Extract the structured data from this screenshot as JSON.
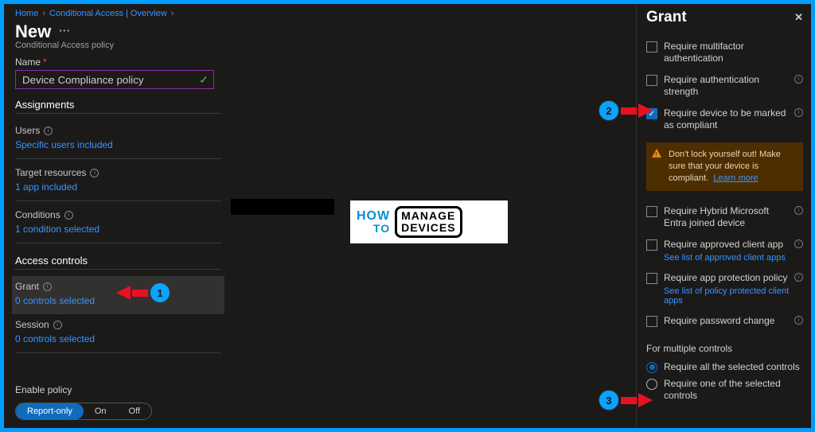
{
  "breadcrumb": {
    "home": "Home",
    "ca": "Conditional Access | Overview"
  },
  "page": {
    "title": "New",
    "subtitle": "Conditional Access policy"
  },
  "name": {
    "label": "Name",
    "value": "Device Compliance policy"
  },
  "sections": {
    "assignments": "Assignments",
    "access_controls": "Access controls"
  },
  "rows": {
    "users": {
      "label": "Users",
      "value": "Specific users included"
    },
    "target": {
      "label": "Target resources",
      "value": "1 app included"
    },
    "conditions": {
      "label": "Conditions",
      "value": "1 condition selected"
    },
    "grant": {
      "label": "Grant",
      "value": "0 controls selected"
    },
    "session": {
      "label": "Session",
      "value": "0 controls selected"
    }
  },
  "enable": {
    "label": "Enable policy",
    "report": "Report-only",
    "on": "On",
    "off": "Off"
  },
  "grant_panel": {
    "title": "Grant",
    "mfa": "Require multifactor authentication",
    "auth_strength": "Require authentication strength",
    "compliant": "Require device to be marked as compliant",
    "warn": "Don't lock yourself out! Make sure that your device is compliant.",
    "warn_link": "Learn more",
    "hybrid": "Require Hybrid Microsoft Entra joined device",
    "approved": "Require approved client app",
    "approved_link": "See list of approved client apps",
    "app_prot": "Require app protection policy",
    "app_prot_link": "See list of policy protected client apps",
    "pwd": "Require password change",
    "multi_label": "For multiple controls",
    "radio_all": "Require all the selected controls",
    "radio_one": "Require one of the selected controls"
  },
  "callouts": {
    "c1": "1",
    "c2": "2",
    "c3": "3"
  },
  "logo": {
    "how": "HOW",
    "to": "TO",
    "manage": "MANAGE",
    "devices": "DEVICES"
  }
}
